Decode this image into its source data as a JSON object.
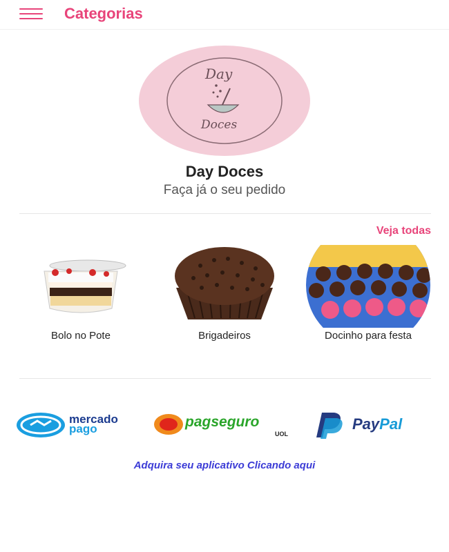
{
  "header": {
    "title": "Categorias",
    "menu_icon": "hamburger-menu-icon"
  },
  "store": {
    "logo_text_top": "Day",
    "logo_text_bottom": "Doces",
    "name": "Day Doces",
    "subtitle": "Faça já o seu pedido"
  },
  "categories": {
    "see_all_label": "Veja todas",
    "items": [
      {
        "label": "Bolo no Pote",
        "icon": "cake-in-jar-image"
      },
      {
        "label": "Brigadeiros",
        "icon": "brigadeiro-image"
      },
      {
        "label": "Docinho para festa",
        "icon": "party-sweets-image"
      }
    ]
  },
  "payments": {
    "mercadopago_line1": "mercado",
    "mercadopago_line2": "pago",
    "pagseguro": "pagseguro",
    "pagseguro_suffix": "UOL",
    "paypal_a": "Pay",
    "paypal_b": "Pal"
  },
  "footer": {
    "app_link": "Adquira seu aplicativo Clicando aqui"
  },
  "colors": {
    "accent": "#e8447a",
    "logo_bg": "#f4cdd8",
    "link": "#3b3bd6",
    "mp_blue": "#1a9ee0",
    "paypal_dark": "#253b80",
    "paypal_light": "#179bd7"
  }
}
